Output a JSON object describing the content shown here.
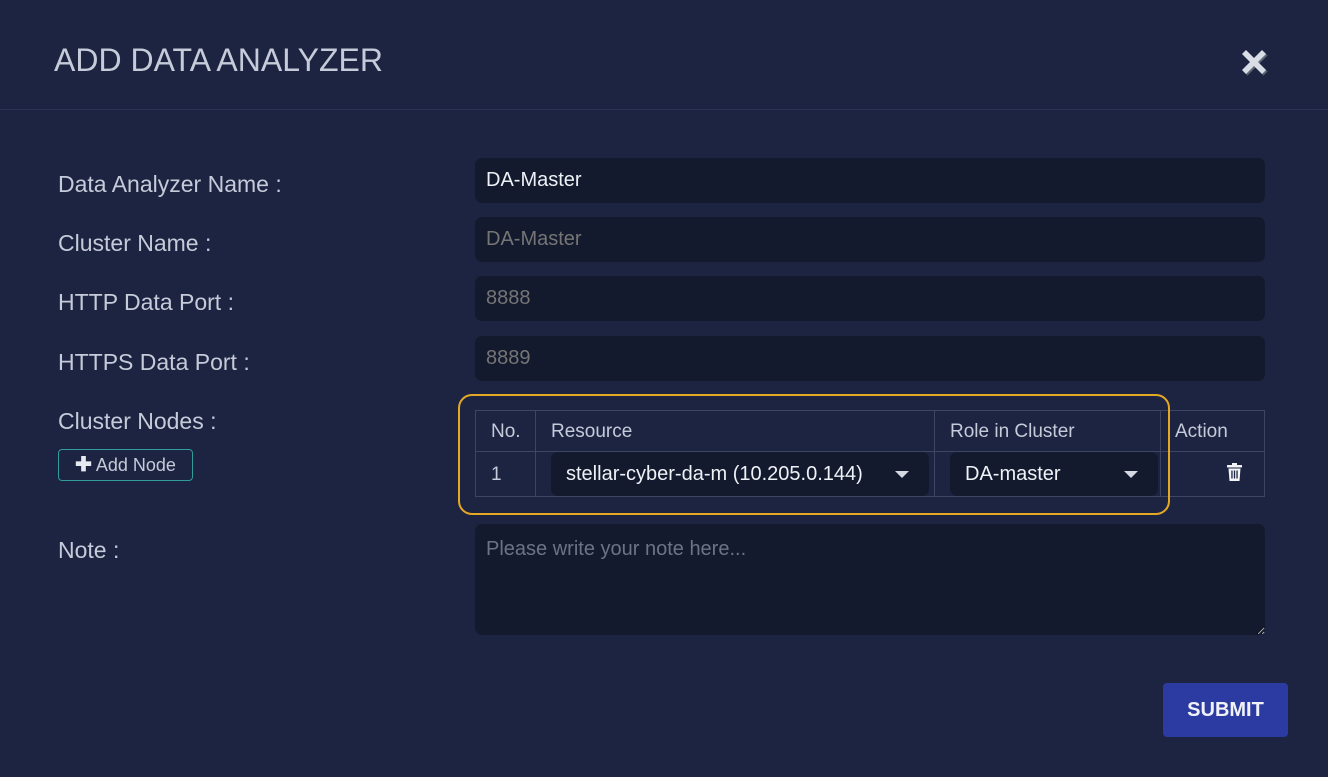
{
  "dialog": {
    "title": "ADD DATA ANALYZER",
    "close_icon": "close-x-icon"
  },
  "form": {
    "name_label": "Data Analyzer Name :",
    "name_value": "DA-Master",
    "cluster_label": "Cluster Name :",
    "cluster_placeholder": "DA-Master",
    "http_label": "HTTP Data Port :",
    "http_placeholder": "8888",
    "https_label": "HTTPS Data Port :",
    "https_placeholder": "8889",
    "nodes_label": "Cluster Nodes :",
    "add_node_label": "Add Node",
    "note_label": "Note :",
    "note_placeholder": "Please write your note here..."
  },
  "nodes_table": {
    "columns": [
      "No.",
      "Resource",
      "Role in Cluster",
      "Action"
    ],
    "rows": [
      {
        "no": "1",
        "resource": "stellar-cyber-da-m (10.205.0.144)",
        "role": "DA-master",
        "action_icon": "trash-icon"
      }
    ]
  },
  "actions": {
    "submit_label": "SUBMIT"
  },
  "colors": {
    "background": "#1c2442",
    "input_bg": "#141a2e",
    "highlight": "#e5a823",
    "submit": "#2b3ba1",
    "add_node_border": "#2f9d9a"
  }
}
